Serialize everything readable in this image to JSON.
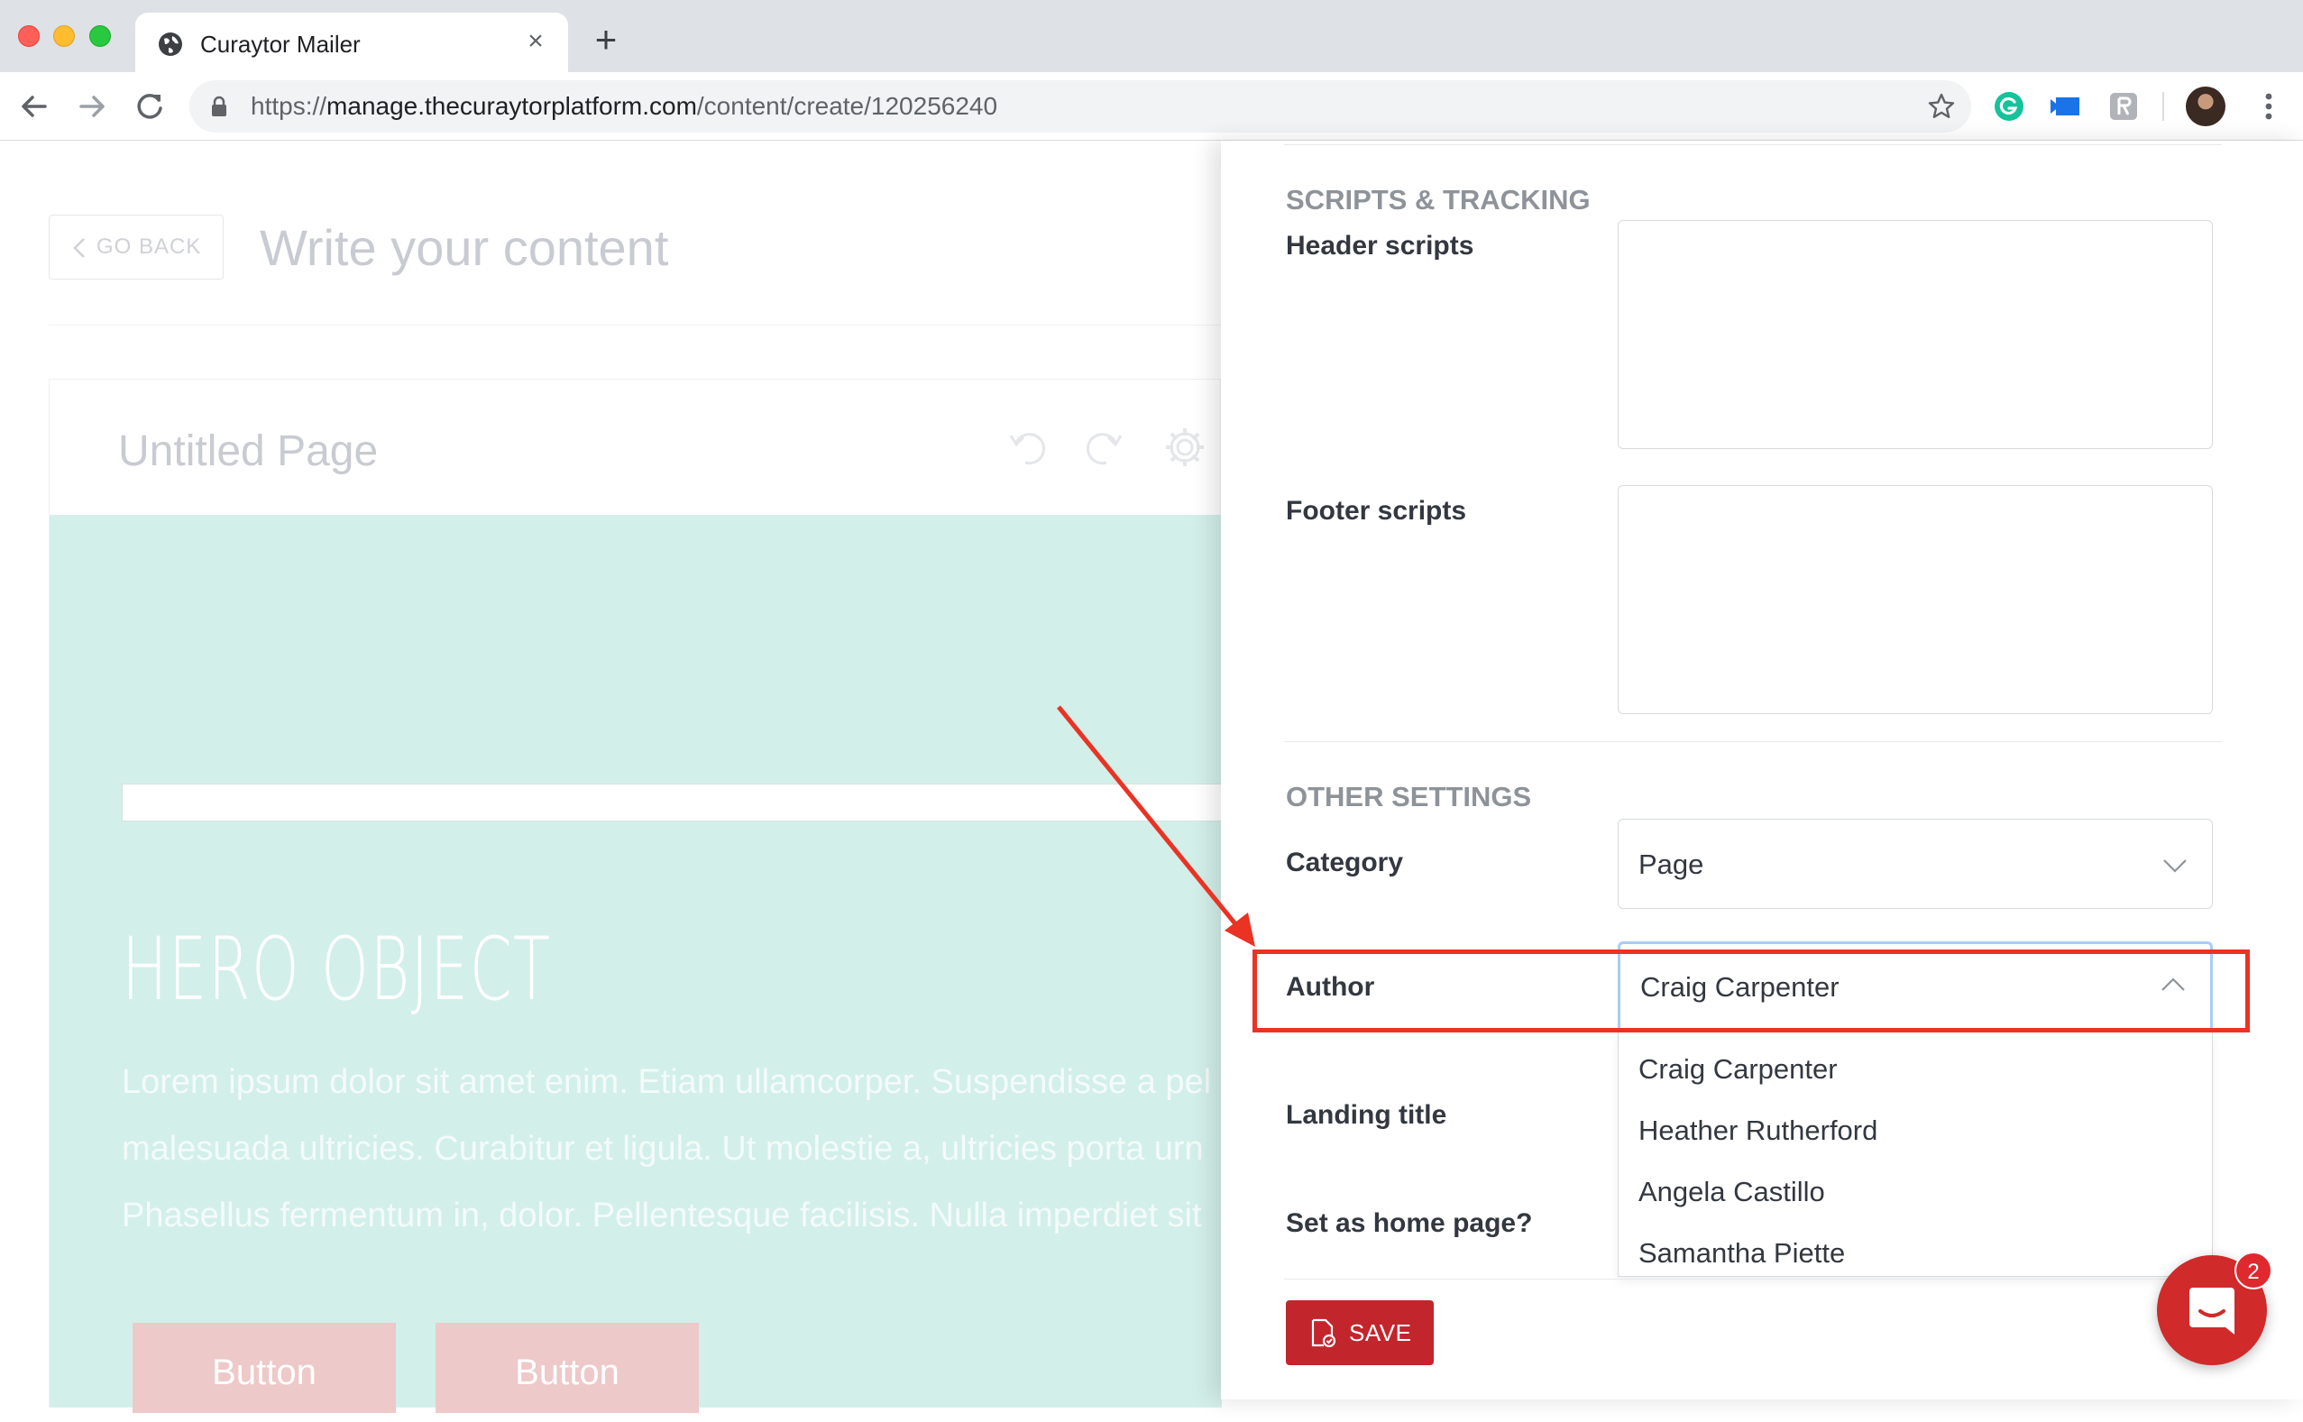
{
  "browser": {
    "tab_title": "Curaytor Mailer",
    "url_scheme": "https://",
    "url_host": "manage.thecuraytorplatform.com",
    "url_path": "/content/create/120256240"
  },
  "page": {
    "go_back_label": "GO BACK",
    "heading": "Write your content",
    "editor_title": "Untitled Page",
    "hero_title": "HERO OBJECT",
    "hero_lines": [
      "Lorem ipsum dolor sit amet enim. Etiam ullamcorper. Suspendisse a pel",
      "malesuada ultricies. Curabitur et ligula. Ut molestie a, ultricies porta urn",
      "Phasellus fermentum in, dolor. Pellentesque facilisis. Nulla imperdiet sit"
    ],
    "hero_buttons": [
      "Button",
      "Button"
    ]
  },
  "panel": {
    "scripts_section": "SCRIPTS & TRACKING",
    "header_scripts_label": "Header scripts",
    "footer_scripts_label": "Footer scripts",
    "other_section": "OTHER SETTINGS",
    "category_label": "Category",
    "category_value": "Page",
    "author_label": "Author",
    "author_value": "Craig Carpenter",
    "author_options": [
      "Craig Carpenter",
      "Heather Rutherford",
      "Angela Castillo",
      "Samantha Piette"
    ],
    "landing_title_label": "Landing title",
    "home_page_label": "Set as home page?",
    "save_label": "SAVE"
  },
  "chat": {
    "badge_count": "2"
  },
  "colors": {
    "accent": "#c2262c",
    "annotation": "#ea3323",
    "hero_bg": "#d3efea",
    "focus_border": "#a8ccf7"
  }
}
